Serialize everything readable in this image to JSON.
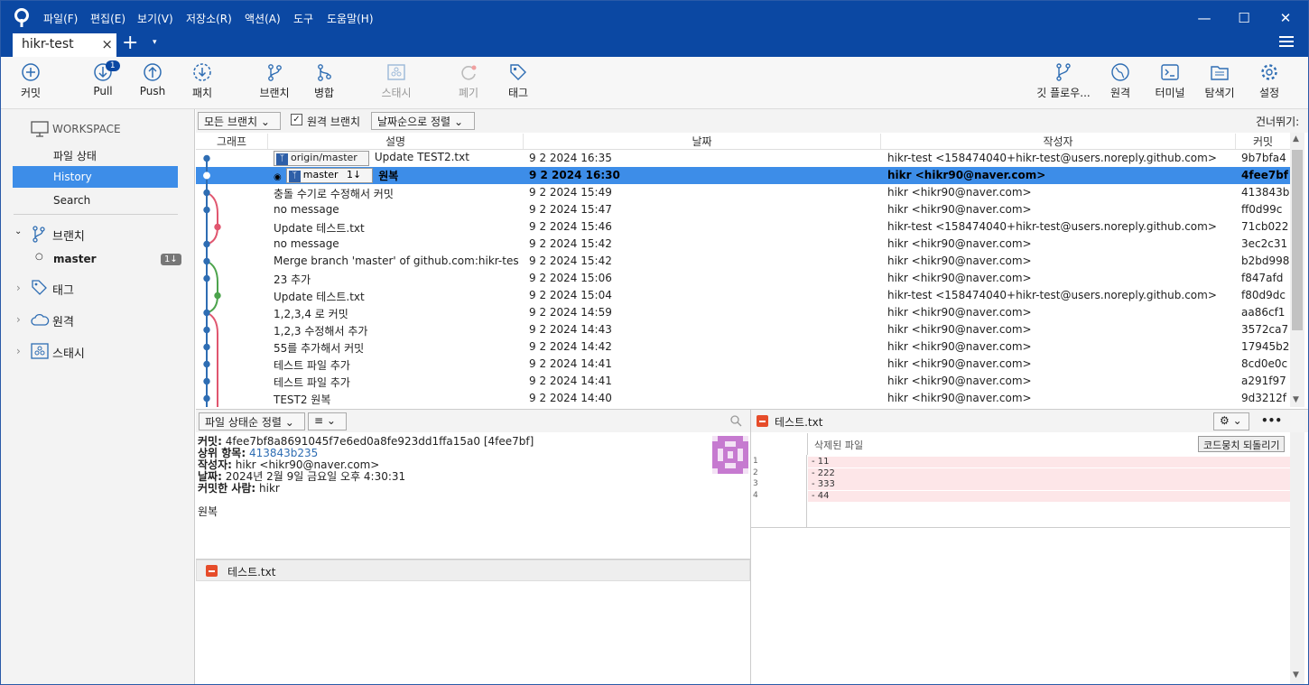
{
  "menu": [
    "파일(F)",
    "편집(E)",
    "보기(V)",
    "저장소(R)",
    "액션(A)",
    "도구",
    "도움말(H)"
  ],
  "tab": {
    "title": "hikr-test",
    "close": "×",
    "add": "+",
    "more": "▾"
  },
  "toolbar": {
    "commit": "커밋",
    "pull": "Pull",
    "pull_badge": "1",
    "push": "Push",
    "fetch": "패치",
    "branch": "브랜치",
    "merge": "병합",
    "stash": "스태시",
    "discard": "폐기",
    "tag": "태그",
    "gitflow": "깃 플로우...",
    "remote": "원격",
    "terminal": "터미널",
    "explorer": "탐색기",
    "settings": "설정"
  },
  "sidebar": {
    "workspace": "WORKSPACE",
    "file_status": "파일 상태",
    "history": "History",
    "search": "Search",
    "branches": "브랜치",
    "master": "master",
    "master_count": "1↓",
    "tags": "태그",
    "remotes": "원격",
    "stashes": "스태시"
  },
  "filter": {
    "branches": "모든 브랜치",
    "remote_branches": "원격 브랜치",
    "sort": "날짜순으로 정렬",
    "skip": "건너뛰기:"
  },
  "columns": {
    "graph": "그래프",
    "desc": "설명",
    "date": "날짜",
    "author": "작성자",
    "commit": "커밋"
  },
  "commits": [
    {
      "ref": "origin/master",
      "desc": "Update TEST2.txt",
      "date": "9 2 2024 16:35",
      "author": "hikr-test <158474040+hikr-test@users.noreply.github.com>",
      "hash": "9b7bfa4"
    },
    {
      "ref": "master",
      "ref_count": "1↓",
      "desc": "원복",
      "date": "9 2 2024 16:30",
      "author": "hikr <hikr90@naver.com>",
      "hash": "4fee7bf"
    },
    {
      "desc": "충돌 수기로 수정해서 커밋",
      "date": "9 2 2024 15:49",
      "author": "hikr <hikr90@naver.com>",
      "hash": "413843b"
    },
    {
      "desc": "no message",
      "date": "9 2 2024 15:47",
      "author": "hikr <hikr90@naver.com>",
      "hash": "ff0d99c"
    },
    {
      "desc": "Update 테스트.txt",
      "date": "9 2 2024 15:46",
      "author": "hikr-test <158474040+hikr-test@users.noreply.github.com>",
      "hash": "71cb022"
    },
    {
      "desc": "no message",
      "date": "9 2 2024 15:42",
      "author": "hikr <hikr90@naver.com>",
      "hash": "3ec2c31"
    },
    {
      "desc": "Merge branch 'master' of github.com:hikr-test/hik",
      "date": "9 2 2024 15:42",
      "author": "hikr <hikr90@naver.com>",
      "hash": "b2bd998"
    },
    {
      "desc": "23 추가",
      "date": "9 2 2024 15:06",
      "author": "hikr <hikr90@naver.com>",
      "hash": "f847afd"
    },
    {
      "desc": "Update 테스트.txt",
      "date": "9 2 2024 15:04",
      "author": "hikr-test <158474040+hikr-test@users.noreply.github.com>",
      "hash": "f80d9dc"
    },
    {
      "desc": "1,2,3,4 로 커밋",
      "date": "9 2 2024 14:59",
      "author": "hikr <hikr90@naver.com>",
      "hash": "aa86cf1"
    },
    {
      "desc": "1,2,3 수정해서 추가",
      "date": "9 2 2024 14:43",
      "author": "hikr <hikr90@naver.com>",
      "hash": "3572ca7"
    },
    {
      "desc": "55를 추가해서 커밋",
      "date": "9 2 2024 14:42",
      "author": "hikr <hikr90@naver.com>",
      "hash": "17945b2"
    },
    {
      "desc": "테스트 파일 추가",
      "date": "9 2 2024 14:41",
      "author": "hikr <hikr90@naver.com>",
      "hash": "8cd0e0c"
    },
    {
      "desc": "테스트 파일 추가",
      "date": "9 2 2024 14:41",
      "author": "hikr <hikr90@naver.com>",
      "hash": "a291f97"
    },
    {
      "desc": "TEST2 원복",
      "date": "9 2 2024 14:40",
      "author": "hikr <hikr90@naver.com>",
      "hash": "9d3212f"
    }
  ],
  "details": {
    "sort": "파일 상태순 정렬",
    "view": "≡",
    "commit_label": "커밋:",
    "commit_value": "4fee7bf8a8691045f7e6ed0a8fe923dd1ffa15a0 [4fee7bf]",
    "parent_label": "상위 항목:",
    "parent_value": "413843b235",
    "author_label": "작성자:",
    "author_value": "hikr <hikr90@naver.com>",
    "date_label": "날짜:",
    "date_value": "2024년 2월 9일 금요일 오후 4:30:31",
    "committer_label": "커밋한 사람:",
    "committer_value": "hikr",
    "message": "원복",
    "file": "테스트.txt"
  },
  "diff": {
    "file": "테스트.txt",
    "status": "삭제된 파일",
    "revert": "코드뭉치 되돌리기",
    "more": "•••",
    "lines": [
      {
        "n": "1",
        "t": "- 11"
      },
      {
        "n": "2",
        "t": "- 222"
      },
      {
        "n": "3",
        "t": "- 333"
      },
      {
        "n": "4",
        "t": "- 44"
      }
    ]
  },
  "colors": {
    "titlebar": "#0b48a3",
    "selection": "#3d8de8",
    "graph_blue": "#2e6db3",
    "graph_pink": "#e0566f",
    "graph_green": "#4ca34c"
  }
}
